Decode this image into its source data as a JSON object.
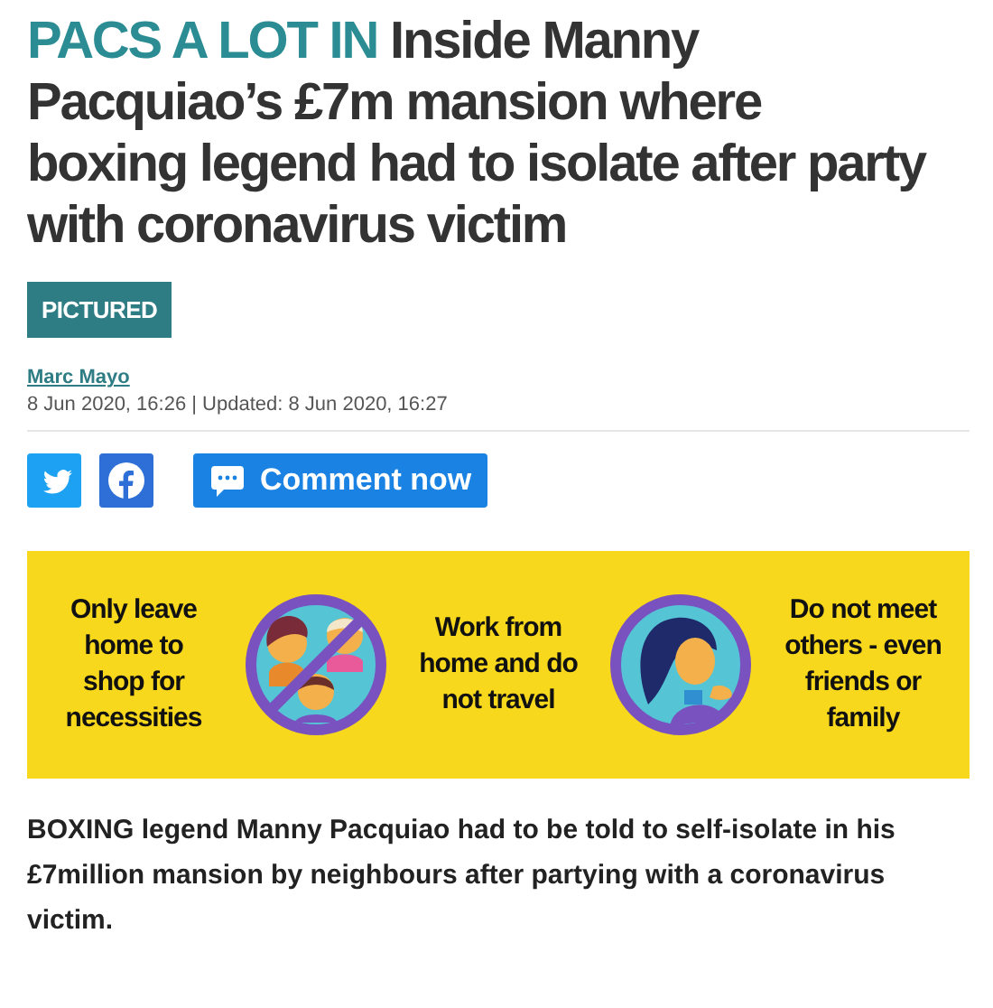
{
  "headline": {
    "kicker": "PACS A LOT IN",
    "title": "Inside Manny Pacquiao’s £7m mansion where boxing legend had to isolate after party with coronavirus victim"
  },
  "tag": "PICTURED",
  "byline": {
    "author": "Marc Mayo",
    "dates": "8 Jun 2020, 16:26 | Updated: 8 Jun 2020, 16:27"
  },
  "share": [
    {
      "kind": "twitter"
    },
    {
      "kind": "facebook"
    },
    {
      "kind": "comment",
      "label": "Comment now"
    }
  ],
  "banner": {
    "panels": [
      {
        "kind": "text",
        "text": "Only leave home to shop for necessities"
      },
      {
        "kind": "crowd"
      },
      {
        "kind": "text",
        "text": "Work from home and do not travel"
      },
      {
        "kind": "sick"
      },
      {
        "kind": "text",
        "text": "Do not meet others - even friends or family"
      }
    ]
  },
  "lead": "BOXING legend Manny Pacquiao had to be told to self-isolate in his £7million mansion by neighbours after partying with a coronavirus victim."
}
